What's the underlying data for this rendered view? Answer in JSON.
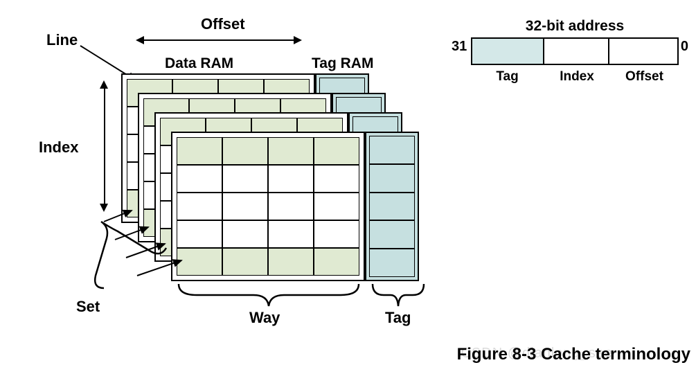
{
  "labels": {
    "line": "Line",
    "offset": "Offset",
    "dataRam": "Data RAM",
    "tagRam": "Tag RAM",
    "index": "Index",
    "set": "Set",
    "way": "Way",
    "tag": "Tag"
  },
  "address": {
    "title": "32-bit address",
    "msb": "31",
    "lsb": "0",
    "fields": {
      "tag": "Tag",
      "index": "Index",
      "offset": "Offset"
    }
  },
  "caption": "Figure 8-3 Cache terminology",
  "watermark": "CSDN @dianlong_see",
  "diagram_meta": {
    "ways": 4,
    "rows_per_way": 5,
    "cols_per_way": 4,
    "highlighted_rows": [
      "top",
      "bottom"
    ],
    "tag_rows": 5
  }
}
